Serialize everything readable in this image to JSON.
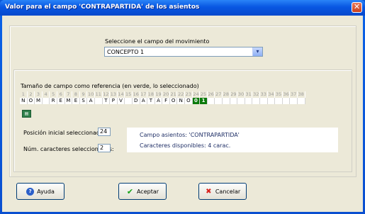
{
  "window": {
    "title": "Valor para el campo 'CONTRAPARTIDA' de los asientos",
    "close": "✕"
  },
  "select_section": {
    "label": "Seleccione el campo del  movimiento",
    "value": "CONCEPTO 1",
    "arrow": "▾"
  },
  "grid_section": {
    "label": "Tamaño de campo como referencia (en verde, lo seleccionado)",
    "numbers": [
      "1",
      "2",
      "3",
      "4",
      "5",
      "6",
      "7",
      "8",
      "9",
      "10",
      "11",
      "12",
      "13",
      "14",
      "15",
      "16",
      "17",
      "18",
      "19",
      "20",
      "21",
      "22",
      "23",
      "24",
      "25",
      "26",
      "27",
      "28",
      "29",
      "30",
      "31",
      "32",
      "33",
      "34",
      "35",
      "36",
      "37",
      "38"
    ],
    "chars": [
      "N",
      "O",
      "M",
      "",
      "R",
      "E",
      "M",
      "E",
      "S",
      "A",
      "",
      "T",
      "P",
      "V",
      "",
      "D",
      "A",
      "T",
      "A",
      "F",
      "O",
      "N",
      "O",
      "0",
      "1",
      "",
      "",
      "",
      "",
      "",
      "",
      "",
      "",
      "",
      "",
      "",
      "",
      ""
    ],
    "selected_positions": [
      24,
      25
    ],
    "icon": "grid-icon"
  },
  "position": {
    "start_label": "Posición inicial seleccionada:",
    "start_value": "24",
    "count_label": "Núm. caracteres seleccionados:",
    "count_value": "2"
  },
  "info": {
    "field_line": "Campo asientos:   'CONTRAPARTIDA'",
    "available_line": "Caracteres disponibles:   4 carac."
  },
  "buttons": {
    "help": "Ayuda",
    "accept": "Aceptar",
    "cancel": "Cancelar"
  },
  "colors": {
    "selected_cell": "#0b7a0b",
    "titlebar": "#0857e2"
  }
}
